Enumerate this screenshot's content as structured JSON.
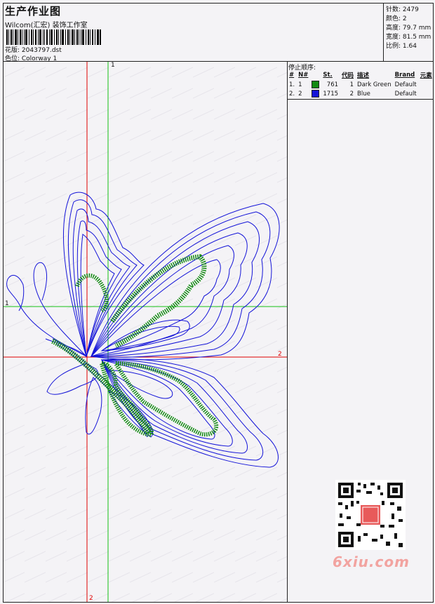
{
  "header": {
    "title": "生产作业图",
    "studio": "Wilcom(汇宏) 装饰工作室",
    "design_label": "花版: 2043797.dst",
    "colorway_label": "色位: Colorway 1"
  },
  "stats": {
    "stitches": "针数: 2479",
    "colors": "颜色: 2",
    "height": "高度: 79.7 mm",
    "width": "宽度: 81.5 mm",
    "scale": "比例: 1.64"
  },
  "stop_sequence": {
    "title": "停止顺序:",
    "columns": [
      "#",
      "N#",
      "St.",
      "代码",
      "描述",
      "Brand",
      "元素"
    ],
    "rows": [
      {
        "idx": "1.",
        "n": "1",
        "color": "#138a13",
        "stitches": "761",
        "code": "1",
        "desc": "Dark Green",
        "brand": "Default"
      },
      {
        "idx": "2.",
        "n": "2",
        "color": "#1414d8",
        "stitches": "1715",
        "code": "2",
        "desc": "Blue",
        "brand": "Default"
      }
    ]
  },
  "axes": {
    "green_top": "1",
    "green_left": "1",
    "red_right": "2",
    "red_bottom": "2"
  },
  "watermark": {
    "text": "6xiu.com",
    "seal": "汉印图章"
  },
  "colors": {
    "thread_green": "#138a13",
    "thread_blue": "#1414d8",
    "axis_red": "#e00000",
    "axis_green": "#16c016"
  }
}
